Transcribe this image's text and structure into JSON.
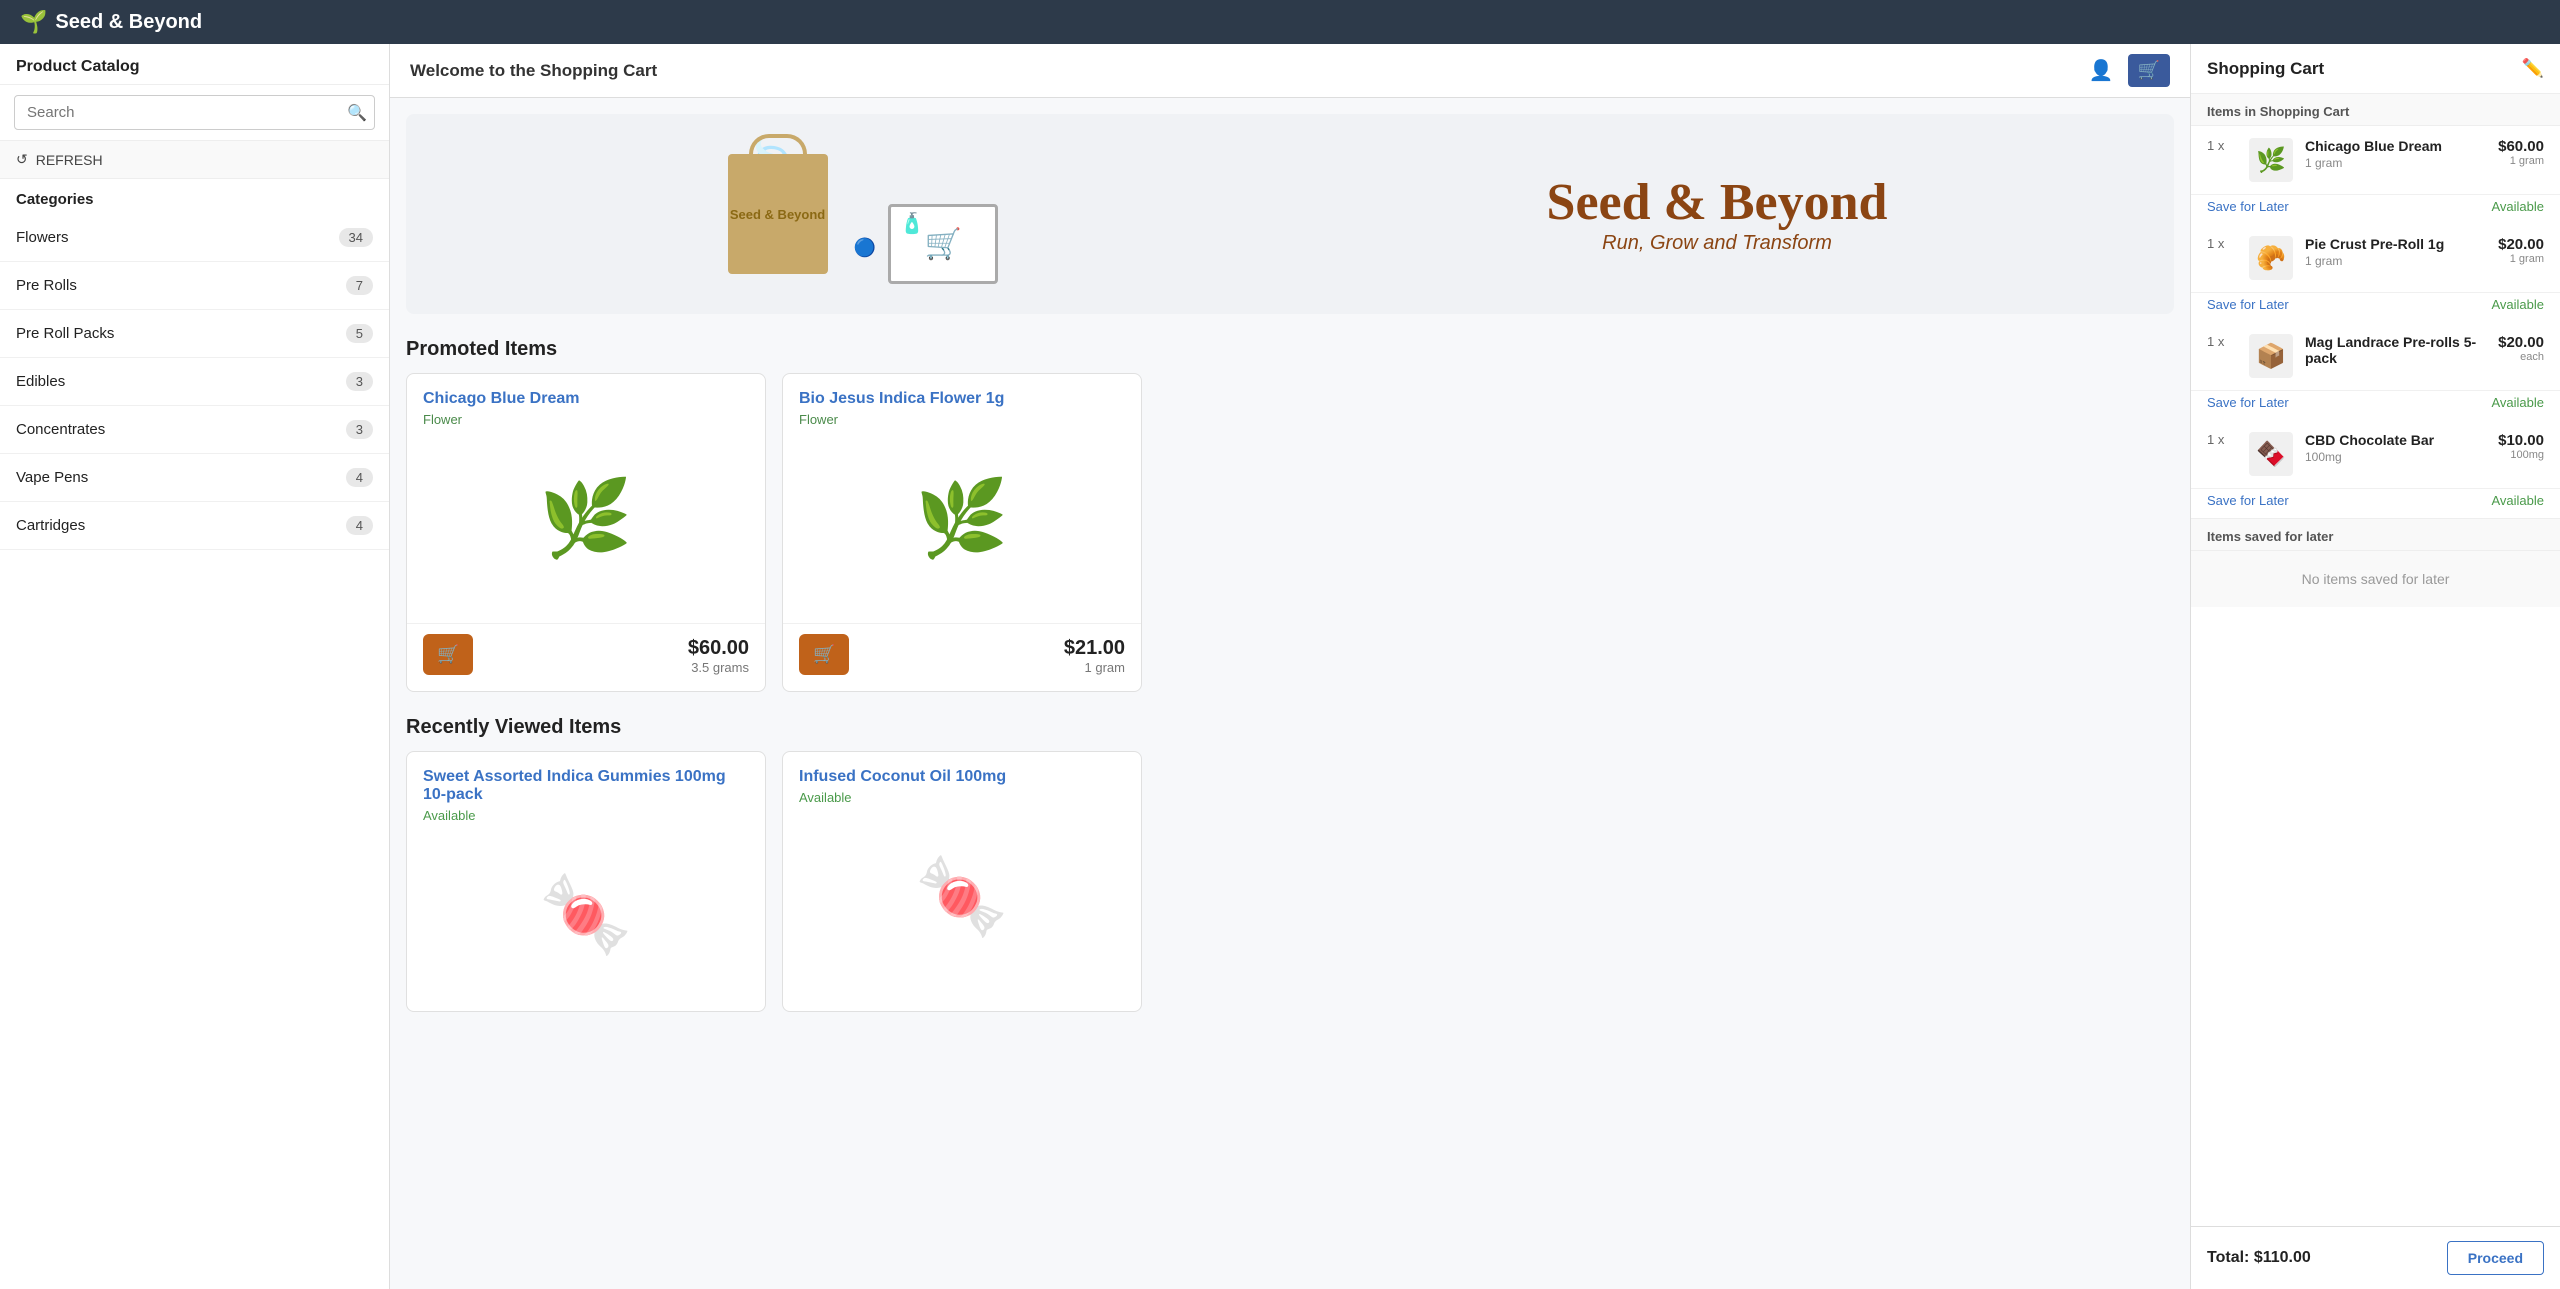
{
  "app": {
    "logo": "Seed & Beyond",
    "logo_icon": "🌱"
  },
  "header": {
    "title": "Welcome to the Shopping Cart"
  },
  "sidebar": {
    "title": "Product Catalog",
    "search_placeholder": "Search",
    "refresh_label": "REFRESH",
    "categories_title": "Categories",
    "categories": [
      {
        "name": "Flowers",
        "count": 34
      },
      {
        "name": "Pre Rolls",
        "count": 7
      },
      {
        "name": "Pre Roll Packs",
        "count": 5
      },
      {
        "name": "Edibles",
        "count": 3
      },
      {
        "name": "Concentrates",
        "count": 3
      },
      {
        "name": "Vape Pens",
        "count": 4
      },
      {
        "name": "Cartridges",
        "count": 4
      }
    ]
  },
  "hero": {
    "brand": "Seed & Beyond",
    "tagline": "Run, Grow and Transform"
  },
  "promoted": {
    "section_title": "Promoted Items",
    "items": [
      {
        "name": "Chicago Blue Dream",
        "type": "Flower",
        "price": "$60.00",
        "unit": "3.5 grams",
        "icon": "🌿"
      },
      {
        "name": "Bio Jesus Indica Flower 1g",
        "type": "Flower",
        "price": "$21.00",
        "unit": "1 gram",
        "icon": "🌿"
      }
    ]
  },
  "recently_viewed": {
    "section_title": "Recently Viewed Items",
    "items": [
      {
        "name": "Sweet Assorted Indica Gummies 100mg 10-pack",
        "status": "Available"
      },
      {
        "name": "Infused Coconut Oil 100mg",
        "status": "Available"
      }
    ]
  },
  "cart": {
    "title": "Shopping Cart",
    "items_label": "Items in Shopping Cart",
    "items": [
      {
        "qty": "1 x",
        "name": "Chicago Blue Dream",
        "sub": "1 gram",
        "price": "$60.00",
        "unit": "1 gram",
        "status": "Available",
        "icon": "🌿"
      },
      {
        "qty": "1 x",
        "name": "Pie Crust Pre-Roll 1g",
        "sub": "1 gram",
        "price": "$20.00",
        "unit": "1 gram",
        "status": "Available",
        "icon": "🥐"
      },
      {
        "qty": "1 x",
        "name": "Mag Landrace Pre-rolls 5-pack",
        "sub": "",
        "price": "$20.00",
        "unit": "each",
        "status": "Available",
        "icon": "📦"
      },
      {
        "qty": "1 x",
        "name": "CBD Chocolate Bar",
        "sub": "100mg",
        "price": "$10.00",
        "unit": "100mg",
        "status": "Available",
        "icon": "🍫"
      }
    ],
    "save_later_label": "Save for Later",
    "available_label": "Available",
    "saved_section_title": "Items saved for later",
    "no_saved_label": "No items saved for later",
    "total_label": "Total:",
    "total_value": "$110.00",
    "proceed_label": "Proceed"
  }
}
